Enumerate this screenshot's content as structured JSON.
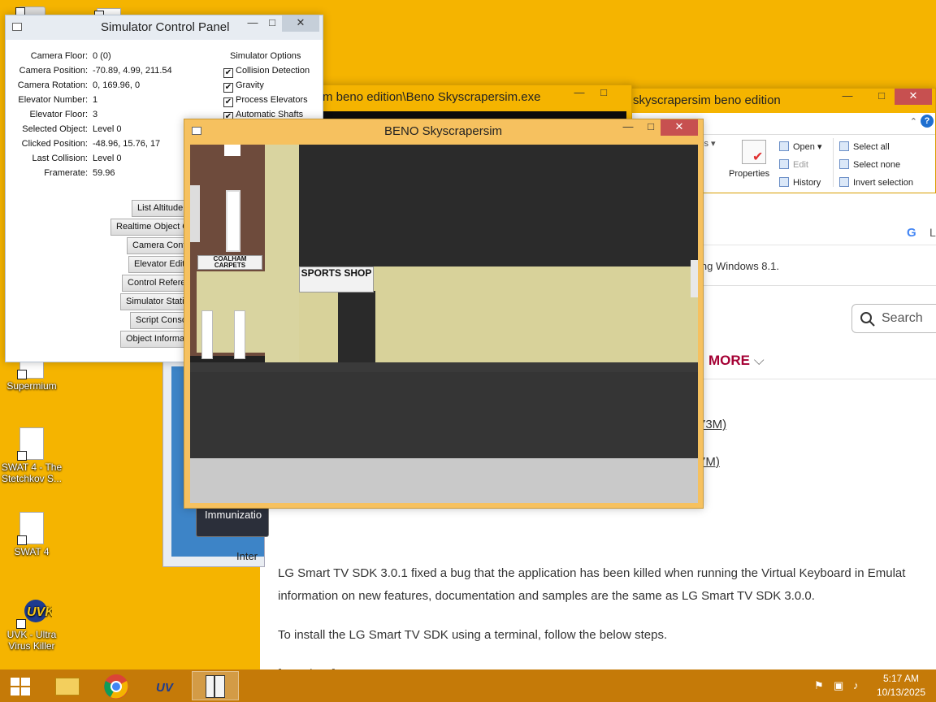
{
  "desktop": {
    "icons": [
      {
        "label": "Supermium"
      },
      {
        "label": "SWAT 4 - The Stetchkov S..."
      },
      {
        "label": "SWAT 4"
      },
      {
        "label": "UVK - Ultra Virus Killer"
      }
    ]
  },
  "explorer": {
    "title": "skyscrapersim beno edition",
    "ribbon": {
      "properties": "Properties",
      "open": "Open",
      "edit": "Edit",
      "history": "History",
      "select_all": "Select all",
      "select_none": "Select none",
      "invert_selection": "Invert selection"
    }
  },
  "console": {
    "title": "m beno edition\\Beno Skyscrapersim.exe"
  },
  "browser": {
    "notice_text": "ing Windows 8.1.",
    "search_placeholder": "Search",
    "nav_more": "MORE",
    "link1": "73M)",
    "link2": "7M)",
    "para1_line1": "LG Smart TV SDK 3.0.1 fixed a bug that the application has been killed when running the Virtual Keyboard in Emulat",
    "para1_line2": "information on new features, documentation and samples are the same as LG Smart TV SDK 3.0.0.",
    "para2": "To install the LG Smart TV SDK using a terminal, follow the below steps.",
    "para3": "[For Linux]"
  },
  "immunization": {
    "button_label": "Immunizatio",
    "inter_label": "Inter"
  },
  "control_panel": {
    "title": "Simulator Control Panel",
    "fields": [
      {
        "key": "Camera Floor:",
        "value": "0 (0)"
      },
      {
        "key": "Camera Position:",
        "value": "-70.89, 4.99, 211.54"
      },
      {
        "key": "Camera Rotation:",
        "value": "0, 169.96, 0"
      },
      {
        "key": "Elevator Number:",
        "value": "1"
      },
      {
        "key": "Elevator Floor:",
        "value": "3"
      },
      {
        "key": "Selected Object:",
        "value": "Level 0"
      },
      {
        "key": "Clicked Position:",
        "value": "-48.96, 15.76, 17"
      },
      {
        "key": "Last Collision:",
        "value": "Level 0"
      },
      {
        "key": "Framerate:",
        "value": "59.96"
      }
    ],
    "options_heading": "Simulator Options",
    "options": [
      {
        "label": "Collision Detection",
        "checked": true
      },
      {
        "label": "Gravity",
        "checked": true
      },
      {
        "label": "Process Elevators",
        "checked": true
      },
      {
        "label": "Automatic Shafts",
        "checked": true
      }
    ],
    "buttons": [
      "List Altitude",
      "Realtime Object C",
      "Camera Cont",
      "Elevator Edit",
      "Control Refere",
      "Simulator Stati",
      "Script Conso",
      "Object Informa"
    ]
  },
  "game": {
    "title": "BENO Skyscrapersim",
    "sign_coalham": "COALHAM CARPETS",
    "sign_sports": "SPORTS SHOP"
  },
  "taskbar": {
    "time": "5:17 AM",
    "date": "10/13/2025"
  },
  "colors": {
    "desktop": "#f5b400",
    "taskbar": "#c57a08",
    "lg_accent": "#a50034",
    "close_button": "#c75050"
  }
}
